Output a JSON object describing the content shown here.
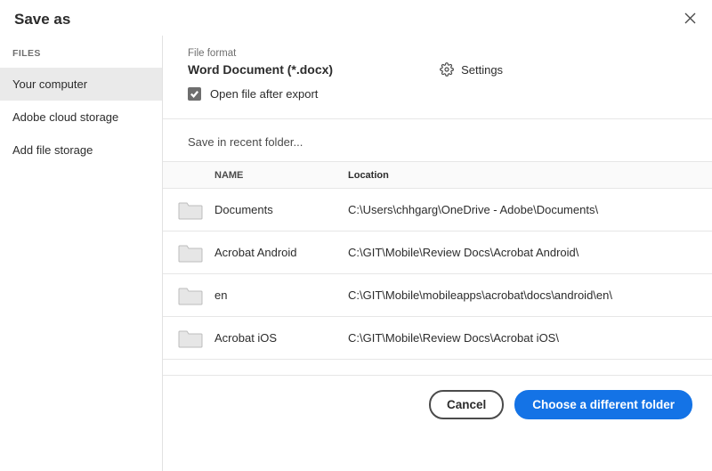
{
  "title": "Save as",
  "sidebar": {
    "header": "FILES",
    "items": [
      {
        "label": "Your computer",
        "selected": true
      },
      {
        "label": "Adobe cloud storage",
        "selected": false
      },
      {
        "label": "Add file storage",
        "selected": false
      }
    ]
  },
  "format": {
    "label": "File format",
    "value": "Word Document (*.docx)",
    "settings_label": "Settings",
    "open_after_label": "Open file after export",
    "open_after_checked": true
  },
  "recent": {
    "heading": "Save in recent folder...",
    "columns": {
      "name": "NAME",
      "location": "Location"
    },
    "rows": [
      {
        "name": "Documents",
        "location": "C:\\Users\\chhgarg\\OneDrive - Adobe\\Documents\\"
      },
      {
        "name": "Acrobat Android",
        "location": "C:\\GIT\\Mobile\\Review Docs\\Acrobat Android\\"
      },
      {
        "name": "en",
        "location": "C:\\GIT\\Mobile\\mobileapps\\acrobat\\docs\\android\\en\\"
      },
      {
        "name": "Acrobat iOS",
        "location": "C:\\GIT\\Mobile\\Review Docs\\Acrobat iOS\\"
      }
    ]
  },
  "buttons": {
    "cancel": "Cancel",
    "choose": "Choose a different folder"
  }
}
